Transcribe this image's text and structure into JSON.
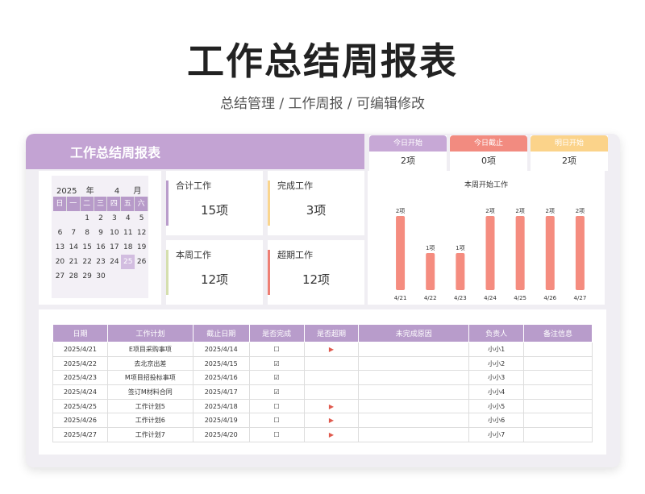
{
  "main_title": "工作总结周报表",
  "sub_title": "总结管理 / 工作周报 /  可编辑修改",
  "sheet_title": "工作总结周报表",
  "kpis": [
    {
      "label": "今日开始",
      "value": "2项",
      "color": "#c7a8d6"
    },
    {
      "label": "今日截止",
      "value": "0项",
      "color": "#f28b80"
    },
    {
      "label": "明日开始",
      "value": "2项",
      "color": "#fbd38a"
    }
  ],
  "calendar": {
    "year": "2025",
    "year_label": "年",
    "month": "4",
    "month_label": "月",
    "weekdays": [
      "日",
      "一",
      "二",
      "三",
      "四",
      "五",
      "六"
    ],
    "weeks": [
      [
        "",
        "",
        "1",
        "2",
        "3",
        "4",
        "5"
      ],
      [
        "6",
        "7",
        "8",
        "9",
        "10",
        "11",
        "12"
      ],
      [
        "13",
        "14",
        "15",
        "16",
        "17",
        "18",
        "19"
      ],
      [
        "20",
        "21",
        "22",
        "23",
        "24",
        "25",
        "26"
      ],
      [
        "27",
        "28",
        "29",
        "30",
        "",
        "",
        ""
      ]
    ],
    "today": "25"
  },
  "stats": [
    {
      "label": "合计工作",
      "value": "15项",
      "color": "#b99ccb"
    },
    {
      "label": "完成工作",
      "value": "3项",
      "color": "#f9d58f"
    },
    {
      "label": "本周工作",
      "value": "12项",
      "color": "#d5dfae"
    },
    {
      "label": "超期工作",
      "value": "12项",
      "color": "#ee8075"
    }
  ],
  "chart_data": {
    "type": "bar",
    "title": "本周开始工作",
    "categories": [
      "4/21",
      "4/22",
      "4/23",
      "4/24",
      "4/25",
      "4/26",
      "4/27"
    ],
    "values": [
      2,
      1,
      1,
      2,
      2,
      2,
      2
    ],
    "data_labels": [
      "2项",
      "1项",
      "1项",
      "2项",
      "2项",
      "2项",
      "2项"
    ],
    "ylim": [
      0,
      2
    ],
    "bar_color": "#f58c7f"
  },
  "table": {
    "headers": [
      "日期",
      "工作计划",
      "截止日期",
      "是否完成",
      "是否超期",
      "未完成原因",
      "负责人",
      "备注信息"
    ],
    "rows": [
      {
        "date": "2025/4/21",
        "plan": "E项目采购事项",
        "due": "2025/4/14",
        "done": "☐",
        "overdue": "▶",
        "reason": "",
        "owner": "小小1",
        "note": ""
      },
      {
        "date": "2025/4/22",
        "plan": "去北京出差",
        "due": "2025/4/15",
        "done": "☑",
        "overdue": "",
        "reason": "",
        "owner": "小小2",
        "note": ""
      },
      {
        "date": "2025/4/23",
        "plan": "M项目招投标事项",
        "due": "2025/4/16",
        "done": "☑",
        "overdue": "",
        "reason": "",
        "owner": "小小3",
        "note": ""
      },
      {
        "date": "2025/4/24",
        "plan": "签订M材料合同",
        "due": "2025/4/17",
        "done": "☑",
        "overdue": "",
        "reason": "",
        "owner": "小小4",
        "note": ""
      },
      {
        "date": "2025/4/25",
        "plan": "工作计划5",
        "due": "2025/4/18",
        "done": "☐",
        "overdue": "▶",
        "reason": "",
        "owner": "小小5",
        "note": ""
      },
      {
        "date": "2025/4/26",
        "plan": "工作计划6",
        "due": "2025/4/19",
        "done": "☐",
        "overdue": "▶",
        "reason": "",
        "owner": "小小6",
        "note": ""
      },
      {
        "date": "2025/4/27",
        "plan": "工作计划7",
        "due": "2025/4/20",
        "done": "☐",
        "overdue": "▶",
        "reason": "",
        "owner": "小小7",
        "note": ""
      }
    ]
  }
}
